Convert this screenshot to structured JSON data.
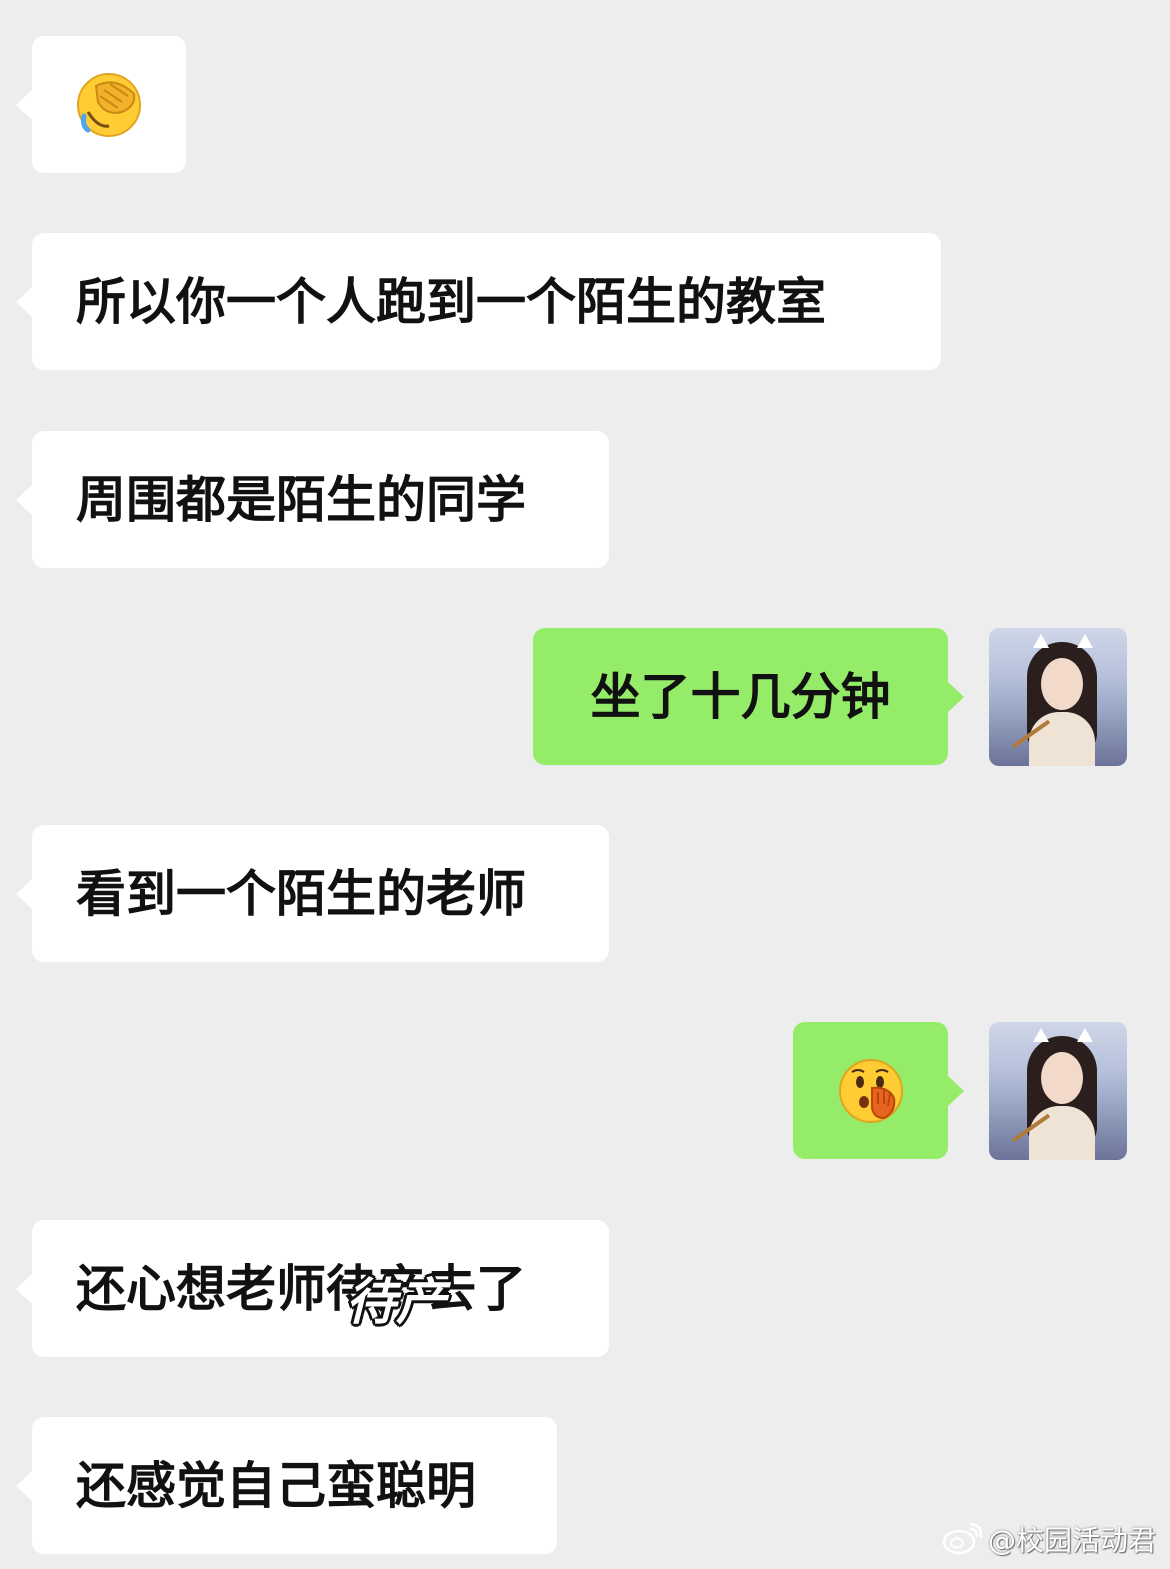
{
  "messages": [
    {
      "side": "left",
      "type": "emoji",
      "icon": "facepalm-crying-emoji"
    },
    {
      "side": "left",
      "type": "text",
      "text": "所以你一个人跑到一个陌生的教室"
    },
    {
      "side": "left",
      "type": "text",
      "text": "周围都是陌生的同学"
    },
    {
      "side": "right",
      "type": "text",
      "text": "坐了十几分钟"
    },
    {
      "side": "left",
      "type": "text",
      "text": "看到一个陌生的老师"
    },
    {
      "side": "right",
      "type": "emoji",
      "icon": "shocked-hand-over-mouth-emoji"
    },
    {
      "side": "left",
      "type": "text",
      "text": "还心想老师待产去了"
    },
    {
      "side": "left",
      "type": "text",
      "text": "还感觉自己蛮聪明"
    }
  ],
  "overlay_text": "待产",
  "watermark": {
    "handle": "@校园活动君",
    "icon": "weibo-logo-icon"
  },
  "colors": {
    "background": "#ededed",
    "left_bubble": "#ffffff",
    "right_bubble": "#95ec69"
  }
}
